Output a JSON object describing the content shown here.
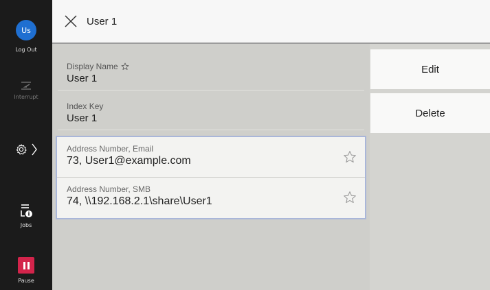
{
  "sidebar": {
    "avatar_initials": "Us",
    "logout_label": "Log Out",
    "interrupt_label": "Interrupt",
    "jobs_label": "Jobs",
    "pause_label": "Pause",
    "icons": [
      "interrupt-icon",
      "settings-gear-icon",
      "chevron-right-icon",
      "jobs-printer-info-icon",
      "pause-icon"
    ],
    "colors": {
      "background": "#1b1b1b",
      "avatar": "#1f6fd1",
      "pause": "#d3244b"
    }
  },
  "header": {
    "title": "User 1",
    "close_icon": "close-x-icon"
  },
  "fields": [
    {
      "label": "Display Name",
      "value": "User 1",
      "has_star": true
    },
    {
      "label": "Index Key",
      "value": "User 1"
    }
  ],
  "address_group": [
    {
      "label": "Address Number, Email",
      "value": "73, User1@example.com",
      "star_icon": "star-outline-icon"
    },
    {
      "label": "Address Number, SMB",
      "value": "74, \\\\192.168.2.1\\share\\User1",
      "star_icon": "star-outline-icon"
    }
  ],
  "actions": {
    "edit_label": "Edit",
    "delete_label": "Delete"
  }
}
